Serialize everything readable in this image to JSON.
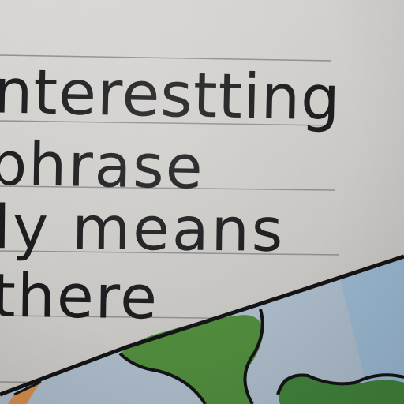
{
  "handwriting": {
    "line1": "nterestting",
    "line2": "phrase",
    "line3": "ly means",
    "line4": "there"
  },
  "colors": {
    "paper": "#d2d0cd",
    "ink": "#1b1b1d",
    "ruled_line": "#8f8e8c",
    "land_green": "#4f8a3c",
    "water_blue": "#a9bccd",
    "sand_orange": "#d08a4a"
  }
}
